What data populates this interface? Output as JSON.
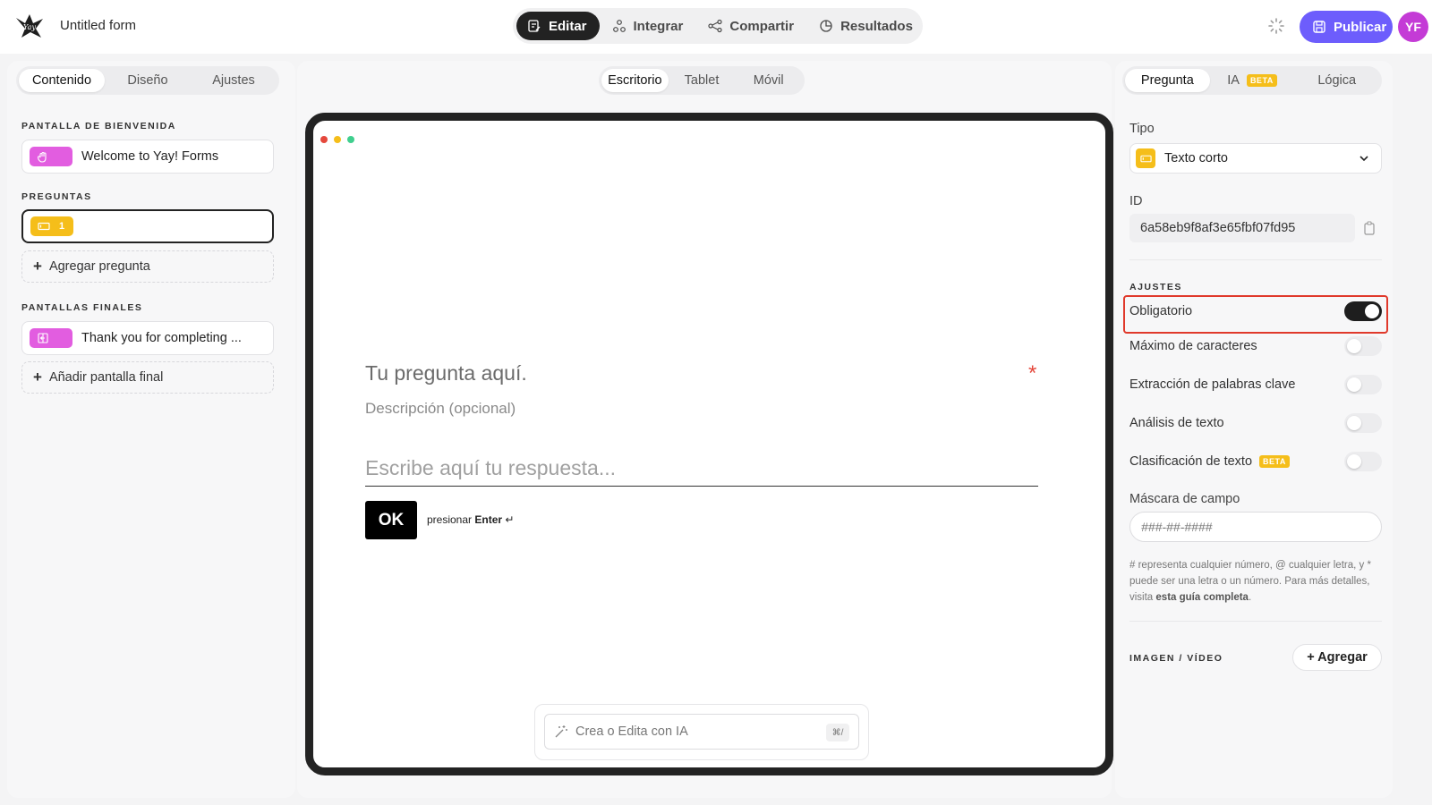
{
  "header": {
    "form_title": "Untitled form",
    "modes": [
      {
        "label": "Editar",
        "icon": "edit-icon",
        "active": true
      },
      {
        "label": "Integrar",
        "icon": "integrate-icon",
        "active": false
      },
      {
        "label": "Compartir",
        "icon": "share-icon",
        "active": false
      },
      {
        "label": "Resultados",
        "icon": "results-icon",
        "active": false
      }
    ],
    "publish_label": "Publicar",
    "avatar_initials": "YF",
    "brand_color": "#6d5dfc",
    "avatar_color": "#c43bd6"
  },
  "left": {
    "tabs": [
      "Contenido",
      "Diseño",
      "Ajustes"
    ],
    "active_tab": "Contenido",
    "welcome_label": "PANTALLA DE BIENVENIDA",
    "welcome_item": "Welcome to Yay! Forms",
    "questions_label": "PREGUNTAS",
    "question_number": "1",
    "add_question": "Agregar pregunta",
    "endings_label": "PANTALLAS FINALES",
    "ending_item": "Thank you for completing ...",
    "add_ending": "Añadir pantalla final"
  },
  "center": {
    "devices": [
      "Escritorio",
      "Tablet",
      "Móvil"
    ],
    "active_device": "Escritorio",
    "question_text": "Tu pregunta aquí.",
    "required_mark": "*",
    "description": "Descripción (opcional)",
    "answer_placeholder": "Escribe aquí tu respuesta...",
    "ok_label": "OK",
    "hint_prefix": "presionar",
    "hint_key": "Enter",
    "hint_symbol": "↵",
    "ai_placeholder": "Crea o Edita con IA",
    "ai_shortcut": "⌘/"
  },
  "right": {
    "tabs": [
      "Pregunta",
      "IA",
      "Lógica"
    ],
    "ia_badge": "BETA",
    "active_tab": "Pregunta",
    "type_label": "Tipo",
    "type_value": "Texto corto",
    "id_label": "ID",
    "id_value": "6a58eb9f8af3e65fbf07fd95",
    "settings_label": "AJUSTES",
    "toggles": [
      {
        "label": "Obligatorio",
        "on": true
      },
      {
        "label": "Máximo de caracteres",
        "on": false
      },
      {
        "label": "Extracción de palabras clave",
        "on": false
      },
      {
        "label": "Análisis de texto",
        "on": false
      },
      {
        "label": "Clasificación de texto",
        "on": false,
        "badge": "BETA"
      }
    ],
    "mask_label": "Máscara de campo",
    "mask_placeholder": "###-##-####",
    "help_text": "# representa cualquier número, @ cualquier letra, y * puede ser una letra o un número. Para más detalles, visita",
    "help_link": "esta guía completa",
    "help_end": ".",
    "media_label": "IMAGEN / VÍDEO",
    "add_media": "+ Agregar"
  }
}
